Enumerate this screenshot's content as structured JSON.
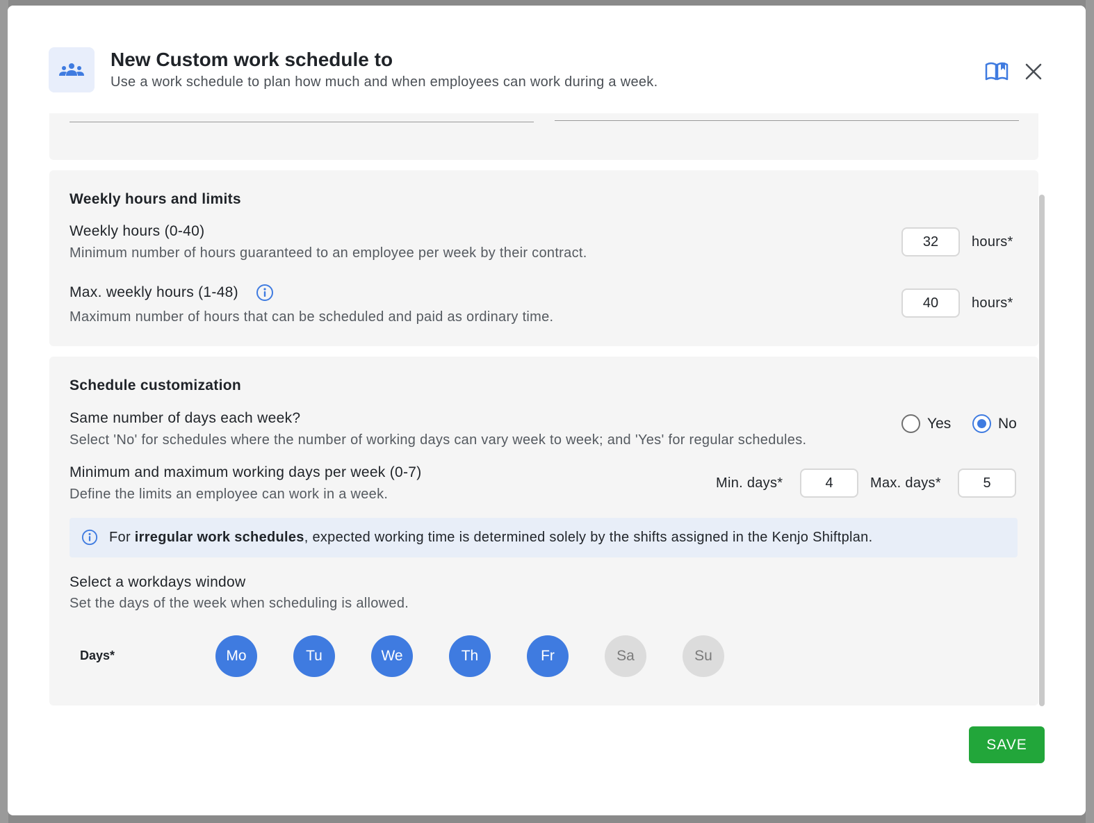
{
  "dialog": {
    "title": "New Custom work schedule to",
    "subtitle": "Use a work schedule to plan how much and when employees can work during a week.",
    "header_icon": "people-group-icon",
    "help_icon": "book-open-icon",
    "close_icon": "close-icon"
  },
  "weekly": {
    "section_title": "Weekly hours and limits",
    "weekly_hours_label": "Weekly hours (0-40)",
    "weekly_hours_desc": "Minimum number of hours guaranteed to an employee per week by their contract.",
    "weekly_hours_value": "32",
    "weekly_hours_unit": "hours*",
    "max_hours_label": "Max. weekly hours (1-48)",
    "max_hours_desc": "Maximum number of hours that can be scheduled and paid as ordinary time.",
    "max_hours_value": "40",
    "max_hours_unit": "hours*",
    "info_icon": "info-icon"
  },
  "schedule": {
    "section_title": "Schedule customization",
    "same_days_label": "Same number of days each week?",
    "same_days_desc": "Select 'No' for schedules where the number of working days can vary week to week; and 'Yes' for regular schedules.",
    "radio_yes": "Yes",
    "radio_no": "No",
    "selected": "No",
    "minmax_label": "Minimum and maximum working days per week (0-7)",
    "minmax_desc": "Define the limits an employee can work in a week.",
    "min_days_label": "Min. days*",
    "min_days_value": "4",
    "max_days_label": "Max. days*",
    "max_days_value": "5",
    "notice_prefix": "For ",
    "notice_bold": "irregular work schedules",
    "notice_suffix": ", expected working time is determined solely by the shifts assigned in the Kenjo Shiftplan.",
    "window_label": "Select a workdays window",
    "window_desc": "Set the days of the week when scheduling is allowed.",
    "days_label": "Days*",
    "days": [
      {
        "label": "Mo",
        "selected": true
      },
      {
        "label": "Tu",
        "selected": true
      },
      {
        "label": "We",
        "selected": true
      },
      {
        "label": "Th",
        "selected": true
      },
      {
        "label": "Fr",
        "selected": true
      },
      {
        "label": "Sa",
        "selected": false
      },
      {
        "label": "Su",
        "selected": false
      }
    ]
  },
  "footer": {
    "save_label": "SAVE"
  },
  "colors": {
    "accent": "#3f7be0",
    "save": "#22a63a",
    "card_bg": "#f5f5f5",
    "notice_bg": "#e8eef8"
  }
}
